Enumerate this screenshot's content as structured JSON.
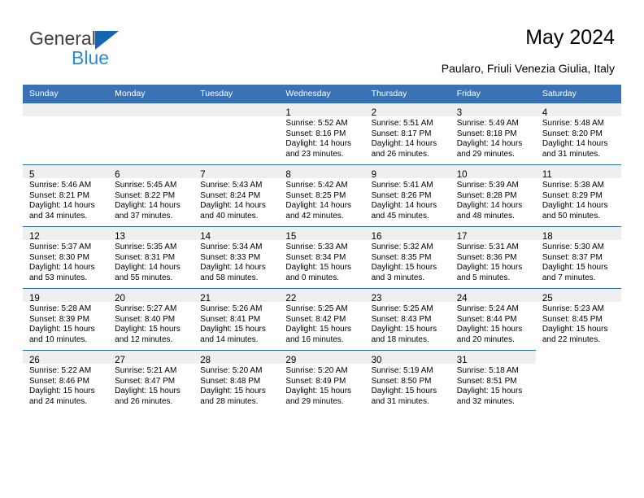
{
  "brand": {
    "name_line1": "General",
    "name_line2": "Blue",
    "primary_color": "#3A72B6",
    "accent_color": "#2e8ad6"
  },
  "header": {
    "title": "May 2024",
    "subtitle": "Paularo, Friuli Venezia Giulia, Italy"
  },
  "calendar": {
    "weekday_headers": [
      "Sunday",
      "Monday",
      "Tuesday",
      "Wednesday",
      "Thursday",
      "Friday",
      "Saturday"
    ],
    "weeks": [
      [
        {
          "day": "",
          "lines": []
        },
        {
          "day": "",
          "lines": []
        },
        {
          "day": "",
          "lines": []
        },
        {
          "day": "1",
          "lines": [
            "Sunrise: 5:52 AM",
            "Sunset: 8:16 PM",
            "Daylight: 14 hours",
            "and 23 minutes."
          ]
        },
        {
          "day": "2",
          "lines": [
            "Sunrise: 5:51 AM",
            "Sunset: 8:17 PM",
            "Daylight: 14 hours",
            "and 26 minutes."
          ]
        },
        {
          "day": "3",
          "lines": [
            "Sunrise: 5:49 AM",
            "Sunset: 8:18 PM",
            "Daylight: 14 hours",
            "and 29 minutes."
          ]
        },
        {
          "day": "4",
          "lines": [
            "Sunrise: 5:48 AM",
            "Sunset: 8:20 PM",
            "Daylight: 14 hours",
            "and 31 minutes."
          ]
        }
      ],
      [
        {
          "day": "5",
          "lines": [
            "Sunrise: 5:46 AM",
            "Sunset: 8:21 PM",
            "Daylight: 14 hours",
            "and 34 minutes."
          ]
        },
        {
          "day": "6",
          "lines": [
            "Sunrise: 5:45 AM",
            "Sunset: 8:22 PM",
            "Daylight: 14 hours",
            "and 37 minutes."
          ]
        },
        {
          "day": "7",
          "lines": [
            "Sunrise: 5:43 AM",
            "Sunset: 8:24 PM",
            "Daylight: 14 hours",
            "and 40 minutes."
          ]
        },
        {
          "day": "8",
          "lines": [
            "Sunrise: 5:42 AM",
            "Sunset: 8:25 PM",
            "Daylight: 14 hours",
            "and 42 minutes."
          ]
        },
        {
          "day": "9",
          "lines": [
            "Sunrise: 5:41 AM",
            "Sunset: 8:26 PM",
            "Daylight: 14 hours",
            "and 45 minutes."
          ]
        },
        {
          "day": "10",
          "lines": [
            "Sunrise: 5:39 AM",
            "Sunset: 8:28 PM",
            "Daylight: 14 hours",
            "and 48 minutes."
          ]
        },
        {
          "day": "11",
          "lines": [
            "Sunrise: 5:38 AM",
            "Sunset: 8:29 PM",
            "Daylight: 14 hours",
            "and 50 minutes."
          ]
        }
      ],
      [
        {
          "day": "12",
          "lines": [
            "Sunrise: 5:37 AM",
            "Sunset: 8:30 PM",
            "Daylight: 14 hours",
            "and 53 minutes."
          ]
        },
        {
          "day": "13",
          "lines": [
            "Sunrise: 5:35 AM",
            "Sunset: 8:31 PM",
            "Daylight: 14 hours",
            "and 55 minutes."
          ]
        },
        {
          "day": "14",
          "lines": [
            "Sunrise: 5:34 AM",
            "Sunset: 8:33 PM",
            "Daylight: 14 hours",
            "and 58 minutes."
          ]
        },
        {
          "day": "15",
          "lines": [
            "Sunrise: 5:33 AM",
            "Sunset: 8:34 PM",
            "Daylight: 15 hours",
            "and 0 minutes."
          ]
        },
        {
          "day": "16",
          "lines": [
            "Sunrise: 5:32 AM",
            "Sunset: 8:35 PM",
            "Daylight: 15 hours",
            "and 3 minutes."
          ]
        },
        {
          "day": "17",
          "lines": [
            "Sunrise: 5:31 AM",
            "Sunset: 8:36 PM",
            "Daylight: 15 hours",
            "and 5 minutes."
          ]
        },
        {
          "day": "18",
          "lines": [
            "Sunrise: 5:30 AM",
            "Sunset: 8:37 PM",
            "Daylight: 15 hours",
            "and 7 minutes."
          ]
        }
      ],
      [
        {
          "day": "19",
          "lines": [
            "Sunrise: 5:28 AM",
            "Sunset: 8:39 PM",
            "Daylight: 15 hours",
            "and 10 minutes."
          ]
        },
        {
          "day": "20",
          "lines": [
            "Sunrise: 5:27 AM",
            "Sunset: 8:40 PM",
            "Daylight: 15 hours",
            "and 12 minutes."
          ]
        },
        {
          "day": "21",
          "lines": [
            "Sunrise: 5:26 AM",
            "Sunset: 8:41 PM",
            "Daylight: 15 hours",
            "and 14 minutes."
          ]
        },
        {
          "day": "22",
          "lines": [
            "Sunrise: 5:25 AM",
            "Sunset: 8:42 PM",
            "Daylight: 15 hours",
            "and 16 minutes."
          ]
        },
        {
          "day": "23",
          "lines": [
            "Sunrise: 5:25 AM",
            "Sunset: 8:43 PM",
            "Daylight: 15 hours",
            "and 18 minutes."
          ]
        },
        {
          "day": "24",
          "lines": [
            "Sunrise: 5:24 AM",
            "Sunset: 8:44 PM",
            "Daylight: 15 hours",
            "and 20 minutes."
          ]
        },
        {
          "day": "25",
          "lines": [
            "Sunrise: 5:23 AM",
            "Sunset: 8:45 PM",
            "Daylight: 15 hours",
            "and 22 minutes."
          ]
        }
      ],
      [
        {
          "day": "26",
          "lines": [
            "Sunrise: 5:22 AM",
            "Sunset: 8:46 PM",
            "Daylight: 15 hours",
            "and 24 minutes."
          ]
        },
        {
          "day": "27",
          "lines": [
            "Sunrise: 5:21 AM",
            "Sunset: 8:47 PM",
            "Daylight: 15 hours",
            "and 26 minutes."
          ]
        },
        {
          "day": "28",
          "lines": [
            "Sunrise: 5:20 AM",
            "Sunset: 8:48 PM",
            "Daylight: 15 hours",
            "and 28 minutes."
          ]
        },
        {
          "day": "29",
          "lines": [
            "Sunrise: 5:20 AM",
            "Sunset: 8:49 PM",
            "Daylight: 15 hours",
            "and 29 minutes."
          ]
        },
        {
          "day": "30",
          "lines": [
            "Sunrise: 5:19 AM",
            "Sunset: 8:50 PM",
            "Daylight: 15 hours",
            "and 31 minutes."
          ]
        },
        {
          "day": "31",
          "lines": [
            "Sunrise: 5:18 AM",
            "Sunset: 8:51 PM",
            "Daylight: 15 hours",
            "and 32 minutes."
          ]
        },
        {
          "day": "",
          "lines": [],
          "trailing": true
        }
      ]
    ]
  }
}
